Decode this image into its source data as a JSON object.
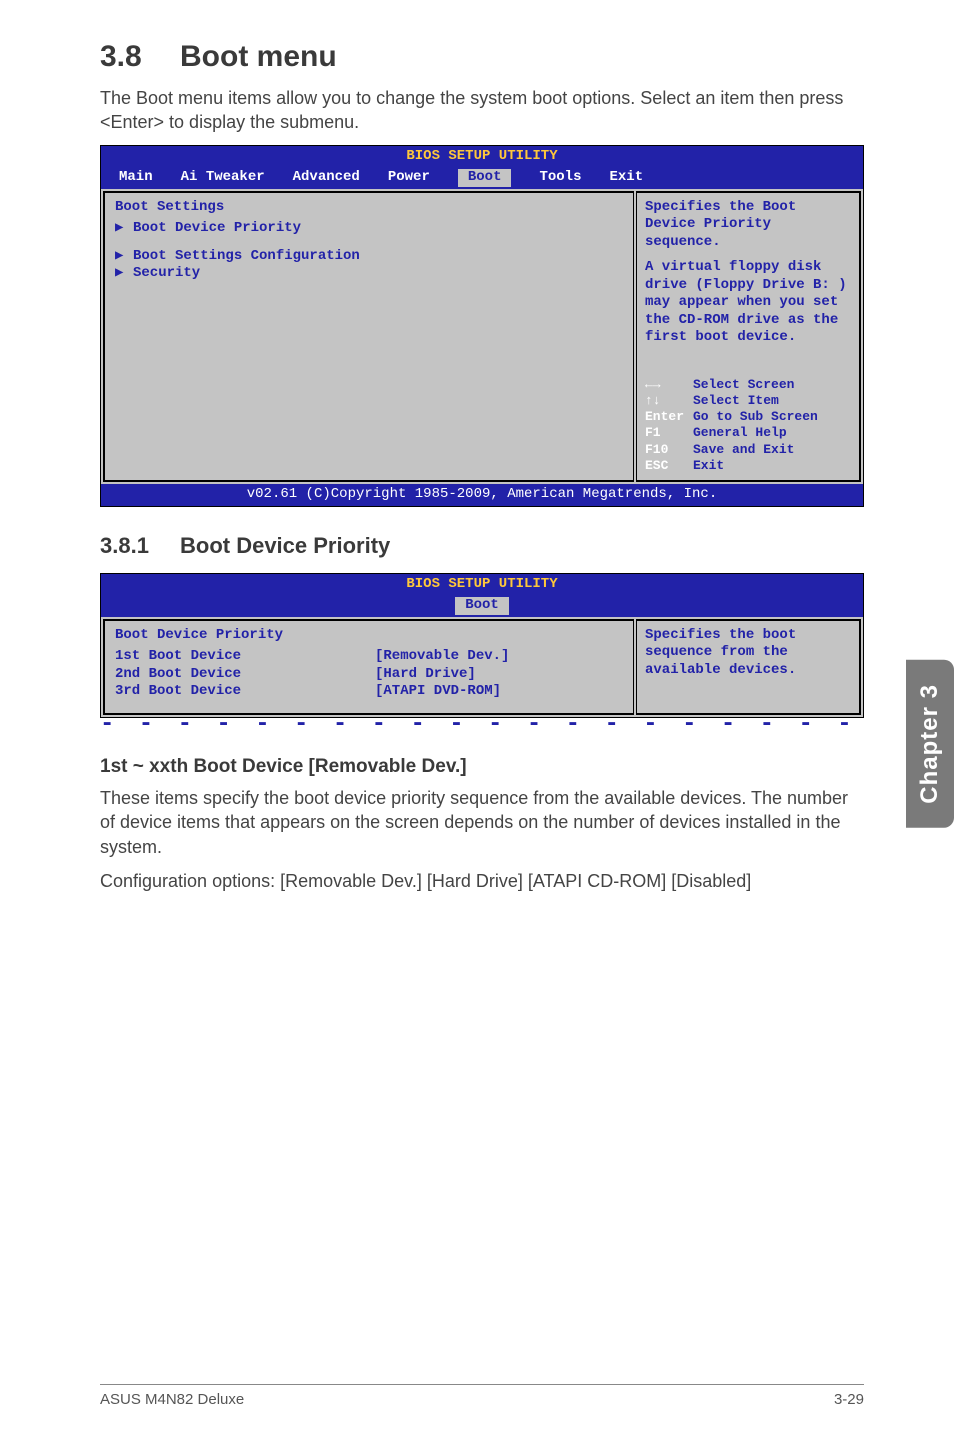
{
  "section": {
    "num": "3.8",
    "title": "Boot menu"
  },
  "intro": "The Boot menu items allow you to change the system boot options. Select an item then press <Enter> to display the submenu.",
  "bios1": {
    "header": "BIOS SETUP UTILITY",
    "tabs": [
      "Main",
      "Ai Tweaker",
      "Advanced",
      "Power",
      "Boot",
      "Tools",
      "Exit"
    ],
    "active_tab": "Boot",
    "group_title": "Boot Settings",
    "items": [
      "Boot Device Priority",
      "Boot Settings Configuration",
      "Security"
    ],
    "help_top": "Specifies the Boot Device Priority sequence.",
    "help_mid": "A virtual floppy disk drive (Floppy Drive B: ) may appear when you set the CD-ROM drive as the first boot device.",
    "keys": [
      {
        "k": "←→",
        "d": "Select Screen"
      },
      {
        "k": "↑↓",
        "d": "Select Item"
      },
      {
        "k": "Enter",
        "d": "Go to Sub Screen"
      },
      {
        "k": "F1",
        "d": "General Help"
      },
      {
        "k": "F10",
        "d": "Save and Exit"
      },
      {
        "k": "ESC",
        "d": "Exit"
      }
    ],
    "footer": "v02.61 (C)Copyright 1985-2009, American Megatrends, Inc."
  },
  "subsection": {
    "num": "3.8.1",
    "title": "Boot Device Priority"
  },
  "bios2": {
    "header": "BIOS SETUP UTILITY",
    "active_tab": "Boot",
    "group_title": "Boot Device Priority",
    "rows": [
      {
        "label": "1st Boot Device",
        "value": "[Removable Dev.]"
      },
      {
        "label": "2nd Boot Device",
        "value": "[Hard Drive]"
      },
      {
        "label": "3rd Boot Device",
        "value": "[ATAPI DVD-ROM]"
      }
    ],
    "help": "Specifies the boot sequence from the available devices."
  },
  "para_head": "1st ~ xxth Boot Device [Removable Dev.]",
  "para_body1": "These items specify the boot device priority sequence from the available devices. The number of device items that appears on the screen depends on the number of devices installed in the system.",
  "para_body2": "Configuration options: [Removable Dev.] [Hard Drive] [ATAPI CD-ROM] [Disabled]",
  "side_tab": "Chapter 3",
  "footer": {
    "left": "ASUS M4N82 Deluxe",
    "right": "3-29"
  }
}
